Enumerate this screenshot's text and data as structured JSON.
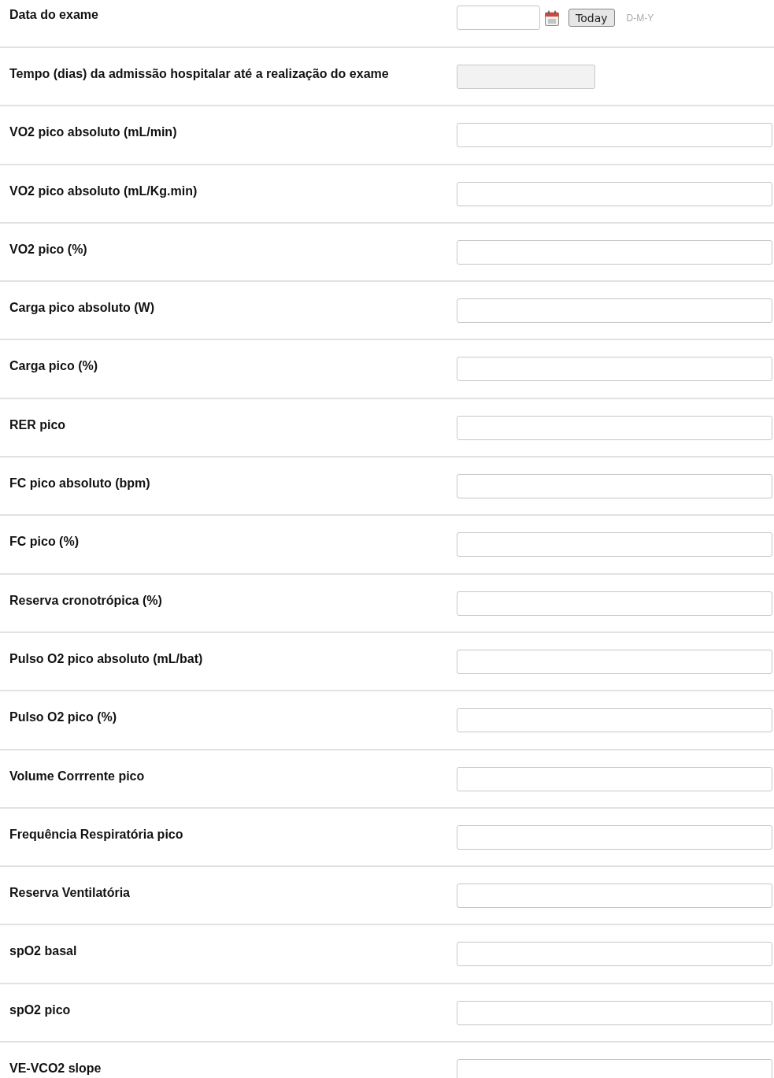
{
  "rows": [
    {
      "label": "Data do exame",
      "kind": "date",
      "button": "Today",
      "format": "D-M-Y"
    },
    {
      "label": "Tempo (dias) da admissão hospitalar até a realização do exame",
      "kind": "readonly"
    },
    {
      "label": "VO2 pico absoluto (mL/min)",
      "kind": "text"
    },
    {
      "label": "VO2 pico absoluto (mL/Kg.min)",
      "kind": "text"
    },
    {
      "label": "VO2 pico (%)",
      "kind": "text"
    },
    {
      "label": "Carga pico absoluto (W)",
      "kind": "text"
    },
    {
      "label": "Carga pico (%)",
      "kind": "text"
    },
    {
      "label": "RER pico",
      "kind": "text"
    },
    {
      "label": "FC pico absoluto (bpm)",
      "kind": "text"
    },
    {
      "label": "FC pico (%)",
      "kind": "text"
    },
    {
      "label": "Reserva cronotrópica (%)",
      "kind": "text"
    },
    {
      "label": "Pulso O2 pico absoluto (mL/bat)",
      "kind": "text"
    },
    {
      "label": "Pulso O2 pico (%)",
      "kind": "text"
    },
    {
      "label": "Volume Corrrente pico",
      "kind": "text"
    },
    {
      "label": "Frequência Respiratória pico",
      "kind": "text"
    },
    {
      "label": "Reserva Ventilatória",
      "kind": "text"
    },
    {
      "label": "spO2 basal",
      "kind": "text"
    },
    {
      "label": "spO2 pico",
      "kind": "text"
    },
    {
      "label": "VE-VCO2 slope",
      "kind": "text"
    }
  ]
}
